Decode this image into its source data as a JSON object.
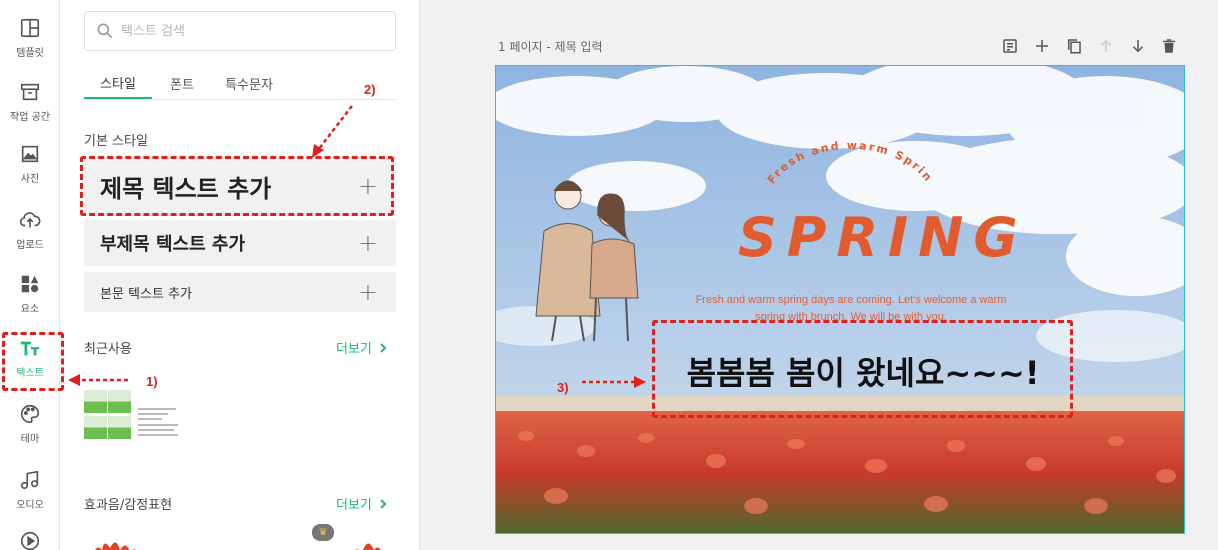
{
  "rail": {
    "items": [
      {
        "label": "템플릿",
        "icon": "template-icon"
      },
      {
        "label": "작업 공간",
        "icon": "workspace-icon"
      },
      {
        "label": "사진",
        "icon": "photo-icon"
      },
      {
        "label": "업로드",
        "icon": "upload-icon"
      },
      {
        "label": "요소",
        "icon": "elements-icon"
      },
      {
        "label": "텍스트",
        "icon": "text-icon",
        "active": true
      },
      {
        "label": "테마",
        "icon": "palette-icon"
      },
      {
        "label": "오디오",
        "icon": "music-icon"
      }
    ]
  },
  "panel": {
    "search_placeholder": "텍스트 검색",
    "tabs": [
      {
        "label": "스타일",
        "active": true
      },
      {
        "label": "폰트"
      },
      {
        "label": "특수문자"
      }
    ],
    "basic_style_title": "기본 스타일",
    "add_heading": "제목 텍스트 추가",
    "add_subheading": "부제목 텍스트 추가",
    "add_body": "본문 텍스트 추가",
    "recent_title": "최근사용",
    "recent_more": "더보기",
    "effects_title": "효과음/감정표현",
    "effects_more": "더보기"
  },
  "annotations": {
    "step1": "1)",
    "step2": "2)",
    "step3": "3)"
  },
  "canvas_header": {
    "page_label": "1 페이지 - 제목 입력"
  },
  "canvas": {
    "arc_text": "Fresh and warm Spring",
    "title": "SPRING",
    "description_line1": "Fresh and warm spring days are coming. Let's welcome a warm",
    "description_line2": "spring with brunch. We will be with you.",
    "main_text": "봄봄봄 봄이 왔네요~~~!"
  },
  "colors": {
    "accent": "#1db972",
    "annotation": "#e0201c",
    "spring_orange": "#e15b2e",
    "selection": "#29c3c8"
  }
}
